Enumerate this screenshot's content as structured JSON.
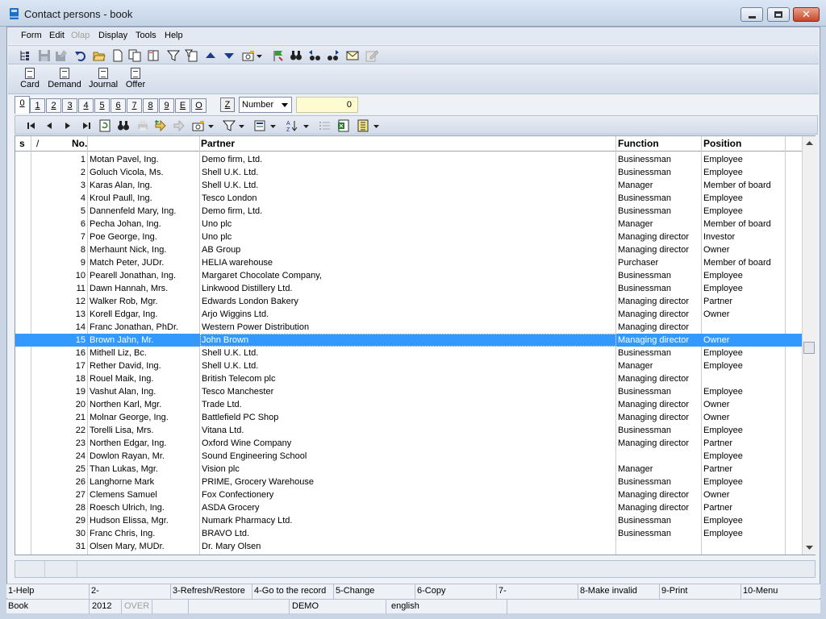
{
  "window": {
    "title": "Contact persons - book",
    "controls": [
      "minimize-icon",
      "restore-icon",
      "close-icon"
    ]
  },
  "menu": [
    {
      "label": "Form",
      "enabled": true
    },
    {
      "label": "Edit",
      "enabled": true
    },
    {
      "label": "Olap",
      "enabled": false
    },
    {
      "label": "Display",
      "enabled": true
    },
    {
      "label": "Tools",
      "enabled": true
    },
    {
      "label": "Help",
      "enabled": true
    }
  ],
  "toolbar1": [
    "tree-icon",
    "save-icon",
    "save-as-icon",
    "undo-icon",
    "open-folder-icon",
    "new-document-icon",
    "copy-document-icon",
    "book-icon",
    "filter-icon",
    "filter-document-icon",
    "arrow-up-icon",
    "arrow-down-icon",
    "camera-icon",
    "dropdown-arrow-icon",
    "flag-icon",
    "binoculars-icon",
    "find-previous-icon",
    "find-next-icon",
    "email-icon",
    "edit-disabled-icon"
  ],
  "toolbar2": {
    "buttons": [
      {
        "label": "Card",
        "icon": "card-document-icon"
      },
      {
        "label": "Demand",
        "icon": "demand-document-icon"
      },
      {
        "label": "Journal",
        "icon": "journal-document-icon"
      },
      {
        "label": "Offer",
        "icon": "offer-document-icon"
      }
    ]
  },
  "tabs": [
    "0",
    "1",
    "2",
    "3",
    "4",
    "5",
    "6",
    "7",
    "8",
    "9",
    "E",
    "O"
  ],
  "active_tab": "0",
  "sort": {
    "z_label": "Z",
    "selected": "Number",
    "search_value": "0"
  },
  "toolbar3": [
    "first-record-icon",
    "previous-record-icon",
    "next-record-icon",
    "last-record-icon",
    "refresh-icon",
    "binoculars-icon",
    "print-disabled-icon",
    "add-icon",
    "remove-disabled-icon",
    "camera-icon",
    "dropdown-arrow-icon",
    "filter-icon",
    "dropdown-arrow-icon",
    "form-icon",
    "dropdown-arrow-icon",
    "sort-az-icon",
    "dropdown-arrow-icon",
    "list-icon",
    "excel-icon",
    "columns-icon",
    "dropdown-arrow-icon"
  ],
  "table": {
    "columns": {
      "s": "s",
      "mark": "/",
      "no": "No.",
      "name": "",
      "partner": "Partner",
      "function": "Function",
      "position": "Position"
    },
    "selected_index": 14,
    "rows": [
      {
        "no": "1",
        "name": "Motan Pavel, Ing.",
        "partner": "Demo firm, Ltd.",
        "function": "Businessman",
        "position": "Employee"
      },
      {
        "no": "2",
        "name": "Goluch Vicola, Ms.",
        "partner": "Shell U.K. Ltd.",
        "function": "Businessman",
        "position": "Employee"
      },
      {
        "no": "3",
        "name": "Karas Alan, Ing.",
        "partner": "Shell U.K. Ltd.",
        "function": "Manager",
        "position": "Member of board"
      },
      {
        "no": "4",
        "name": "Kroul Paull, Ing.",
        "partner": "Tesco London",
        "function": "Businessman",
        "position": "Employee"
      },
      {
        "no": "5",
        "name": "Dannenfeld Mary, Ing.",
        "partner": "Demo firm, Ltd.",
        "function": "Businessman",
        "position": "Employee"
      },
      {
        "no": "6",
        "name": "Pecha Johan, Ing.",
        "partner": "Uno plc",
        "function": "Manager",
        "position": "Member of board"
      },
      {
        "no": "7",
        "name": "Poe George, Ing.",
        "partner": "Uno plc",
        "function": "Managing director",
        "position": "Investor"
      },
      {
        "no": "8",
        "name": "Merhaunt Nick, Ing.",
        "partner": "AB Group",
        "function": "Managing director",
        "position": "Owner"
      },
      {
        "no": "9",
        "name": "Match Peter, JUDr.",
        "partner": "HELIA warehouse",
        "function": "Purchaser",
        "position": "Member of board"
      },
      {
        "no": "10",
        "name": "Pearell Jonathan, Ing.",
        "partner": "Margaret Chocolate Company,",
        "function": "Businessman",
        "position": "Employee"
      },
      {
        "no": "11",
        "name": "Dawn Hannah, Mrs.",
        "partner": "Linkwood Distillery Ltd.",
        "function": "Businessman",
        "position": "Employee"
      },
      {
        "no": "12",
        "name": "Walker Rob, Mgr.",
        "partner": "Edwards London Bakery",
        "function": "Managing director",
        "position": "Partner"
      },
      {
        "no": "13",
        "name": "Korell Edgar, Ing.",
        "partner": "Arjo Wiggins Ltd.",
        "function": "Managing director",
        "position": "Owner"
      },
      {
        "no": "14",
        "name": "Franc Jonathan, PhDr.",
        "partner": "Western Power Distribution",
        "function": "Managing director",
        "position": ""
      },
      {
        "no": "15",
        "name": "Brown Jahn, Mr.",
        "partner": "John Brown",
        "function": "Managing director",
        "position": "Owner"
      },
      {
        "no": "16",
        "name": "Mithell Liz, Bc.",
        "partner": "Shell U.K. Ltd.",
        "function": "Businessman",
        "position": "Employee"
      },
      {
        "no": "17",
        "name": "Rether David, Ing.",
        "partner": "Shell U.K. Ltd.",
        "function": "Manager",
        "position": "Employee"
      },
      {
        "no": "18",
        "name": "Rouel Maik, Ing.",
        "partner": "British Telecom plc",
        "function": "Managing director",
        "position": ""
      },
      {
        "no": "19",
        "name": "Vashut Alan, Ing.",
        "partner": "Tesco Manchester",
        "function": "Businessman",
        "position": "Employee"
      },
      {
        "no": "20",
        "name": "Northen Karl, Mgr.",
        "partner": "Trade Ltd.",
        "function": "Managing director",
        "position": "Owner"
      },
      {
        "no": "21",
        "name": "Molnar George, Ing.",
        "partner": "Battlefield PC Shop",
        "function": "Managing director",
        "position": "Owner"
      },
      {
        "no": "22",
        "name": "Torelli Lisa, Mrs.",
        "partner": "Vitana Ltd.",
        "function": "Businessman",
        "position": "Employee"
      },
      {
        "no": "23",
        "name": "Northen Edgar, Ing.",
        "partner": "Oxford Wine Company",
        "function": "Managing director",
        "position": "Partner"
      },
      {
        "no": "24",
        "name": "Dowlon Rayan, Mr.",
        "partner": "Sound Engineering School",
        "function": "",
        "position": "Employee"
      },
      {
        "no": "25",
        "name": "Than Lukas, Mgr.",
        "partner": "Vision plc",
        "function": "Manager",
        "position": "Partner"
      },
      {
        "no": "26",
        "name": "Langhorne Mark",
        "partner": "PRIME, Grocery Warehouse",
        "function": "Businessman",
        "position": "Employee"
      },
      {
        "no": "27",
        "name": "Clemens Samuel",
        "partner": "Fox Confectionery",
        "function": "Managing director",
        "position": "Owner"
      },
      {
        "no": "28",
        "name": "Roesch Ulrich, Ing.",
        "partner": "ASDA Grocery",
        "function": "Managing director",
        "position": "Partner"
      },
      {
        "no": "29",
        "name": "Hudson Elissa, Mgr.",
        "partner": "Numark Pharmacy Ltd.",
        "function": "Businessman",
        "position": "Employee"
      },
      {
        "no": "30",
        "name": "Franc Chris, Ing.",
        "partner": "BRAVO Ltd.",
        "function": "Businessman",
        "position": "Employee"
      },
      {
        "no": "31",
        "name": "Olsen Mary, MUDr.",
        "partner": "Dr. Mary Olsen",
        "function": "",
        "position": ""
      }
    ]
  },
  "function_keys": [
    "1-Help",
    "2-",
    "3-Refresh/Restore",
    "4-Go to the record",
    "5-Change",
    "6-Copy",
    "7-",
    "8-Make invalid",
    "9-Print",
    "10-Menu"
  ],
  "status": [
    {
      "text": "Book",
      "enabled": true
    },
    {
      "text": "2012",
      "enabled": true
    },
    {
      "text": "OVER",
      "enabled": false
    },
    {
      "text": "",
      "enabled": true
    },
    {
      "text": "",
      "enabled": true
    },
    {
      "text": "DEMO",
      "enabled": true
    },
    {
      "text": "english",
      "enabled": true
    }
  ],
  "colors": {
    "selection": "#3399ff",
    "search_background": "#fffbd0",
    "toolbar": "#d3dcea"
  }
}
